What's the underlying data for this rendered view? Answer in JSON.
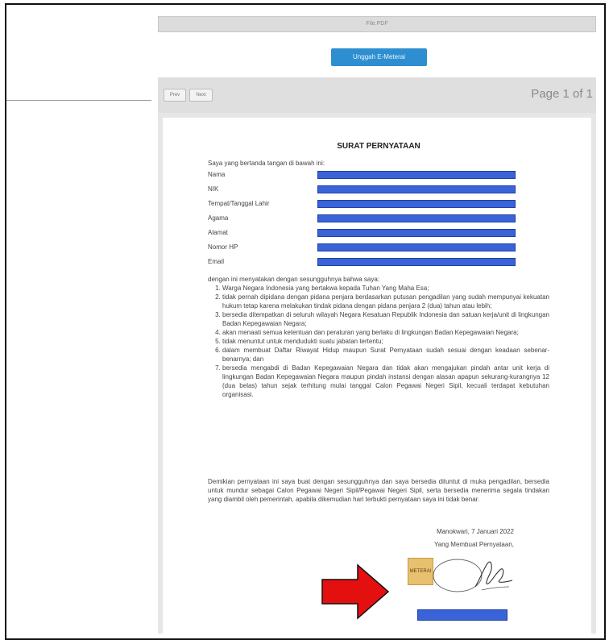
{
  "file_bar": {
    "filename": "File.PDF"
  },
  "upload_button": {
    "label": "Unggah E-Meterai"
  },
  "viewer": {
    "prev_label": "Prev",
    "next_label": "Next",
    "page_count": "Page 1 of 1"
  },
  "document": {
    "title": "SURAT PERNYATAAN",
    "intro": "Saya yang bertanda tangan di bawah ini:",
    "fields": [
      "Nama",
      "NIK",
      "Tempat/Tanggal Lahir",
      "Agama",
      "Alamat",
      "Nomor HP",
      "Email"
    ],
    "declaration_intro": "dengan ini menyatakan dengan sesungguhnya bahwa saya:",
    "points": [
      "Warga Negara Indonesia yang bertakwa kepada Tuhan Yang Maha Esa;",
      "tidak pernah dipidana dengan pidana penjara berdasarkan putusan pengadilan yang sudah mempunyai kekuatan hukum tetap karena melakukan tindak pidana dengan pidana penjara 2 (dua) tahun atau lebih;",
      "bersedia ditempatkan di seluruh wilayah Negara Kesatuan Republik Indonesia dan satuan kerja/unit di lingkungan Badan Kepegawaian Negara;",
      "akan menaati semua ketentuan dan peraturan yang berlaku di lingkungan Badan Kepegawaian Negara;",
      "tidak menuntut untuk mendudukti suatu jabatan tertentu;",
      "dalam membuat Daftar Riwayat Hidup maupun Surat Pernyataan sudah sesuai dengan keadaan sebenar-benarnya; dan",
      "bersedia mengabdi di Badan Kepegawaian Negara dan tidak akan mengajukan pindah antar unit kerja di lingkungan Badan Kepegawaian Negara maupun pindah instansi dengan alasan apapun sekurang-kurangnya 12 (dua belas) tahun sejak terhitung mulai tanggal Calon Pegawai Negeri Sipil, kecuali terdapat kebutuhan organisasi."
    ],
    "closing": "Demikian pernyataan ini saya buat dengan sesungguhnya dan saya bersedia dituntut di muka pengadilan, bersedia untuk mundur sebagai Calon Pegawai Negeri Sipil/Pegawai Negeri Sipil, serta bersedia menerima segala tindakan yang diambil oleh pemerintah, apabila dikemudian hari terbukti pernyataan saya ini tidak benar.",
    "place_date": "Manokwari, 7 Januari 2022",
    "maker_label": "Yang Membuat Pernyataan,",
    "stamp_text": "METERAI"
  },
  "colors": {
    "redaction": "#3b63d8",
    "arrow": "#e41010",
    "button": "#2e8fd0"
  }
}
